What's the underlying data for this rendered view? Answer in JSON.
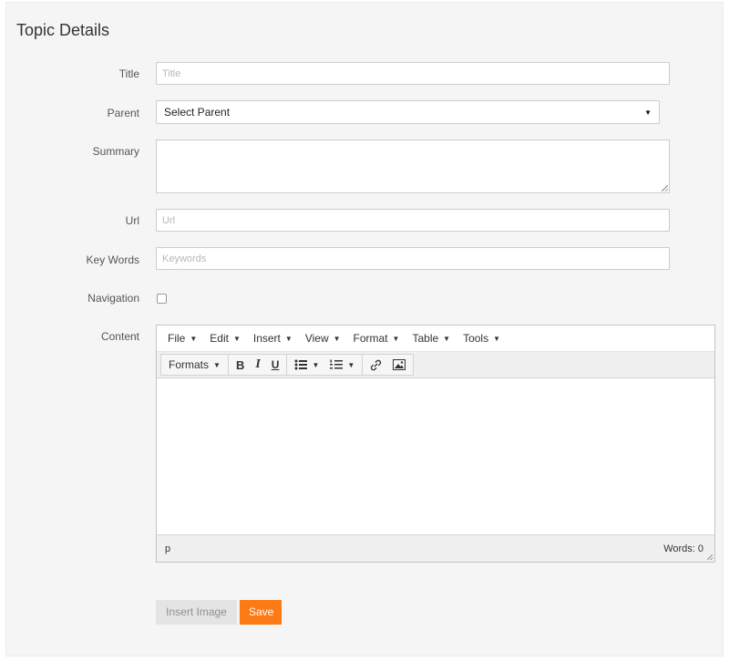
{
  "page": {
    "title": "Topic Details"
  },
  "form": {
    "title": {
      "label": "Title",
      "placeholder": "Title"
    },
    "parent": {
      "label": "Parent",
      "value": "Select Parent"
    },
    "summary": {
      "label": "Summary"
    },
    "url": {
      "label": "Url",
      "placeholder": "Url"
    },
    "keywords": {
      "label": "Key Words",
      "placeholder": "Keywords"
    },
    "navigation": {
      "label": "Navigation",
      "checked": false
    },
    "content": {
      "label": "Content"
    }
  },
  "editor": {
    "menu": [
      "File",
      "Edit",
      "Insert",
      "View",
      "Format",
      "Table",
      "Tools"
    ],
    "toolbar": {
      "formats": "Formats",
      "bold": "B",
      "italic": "I",
      "underline": "U"
    },
    "status": {
      "path": "p",
      "words": "Words: 0"
    }
  },
  "buttons": {
    "insert_image": "Insert Image",
    "save": "Save"
  },
  "colors": {
    "save_button": "#fe7a15",
    "panel_bg": "#f5f5f5"
  }
}
